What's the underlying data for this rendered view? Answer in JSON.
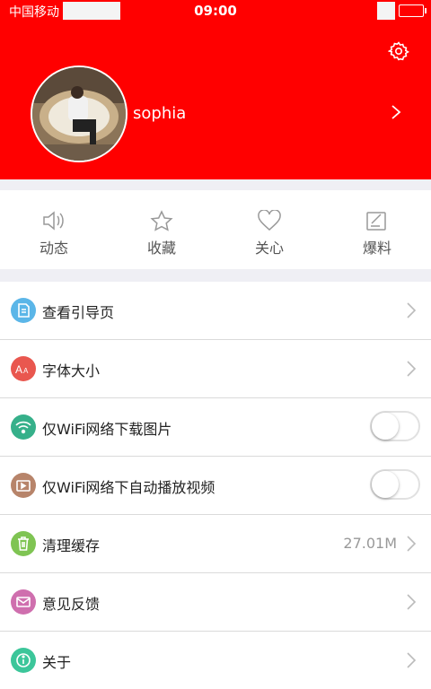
{
  "status": {
    "carrier": "中国移动",
    "time": "09:00"
  },
  "profile": {
    "name": "sophia"
  },
  "actions": [
    {
      "label": "动态",
      "icon": "speaker-icon"
    },
    {
      "label": "收藏",
      "icon": "star-icon"
    },
    {
      "label": "关心",
      "icon": "heart-icon"
    },
    {
      "label": "爆料",
      "icon": "edit-icon"
    }
  ],
  "settings": {
    "guide": {
      "label": "查看引导页",
      "color": "#5bb6e8"
    },
    "font_size": {
      "label": "字体大小",
      "color": "#e9574f"
    },
    "wifi_images": {
      "label": "仅WiFi网络下载图片",
      "color": "#36b08a",
      "on": false
    },
    "wifi_video": {
      "label": "仅WiFi网络下自动播放视频",
      "color": "#b7846a",
      "on": false
    },
    "cache": {
      "label": "清理缓存",
      "value": "27.01M",
      "color": "#7fc453"
    },
    "feedback": {
      "label": "意见反馈",
      "color": "#cf6fae"
    },
    "about": {
      "label": "关于",
      "color": "#3cc69a"
    }
  },
  "colors": {
    "header": "#ff0000"
  }
}
